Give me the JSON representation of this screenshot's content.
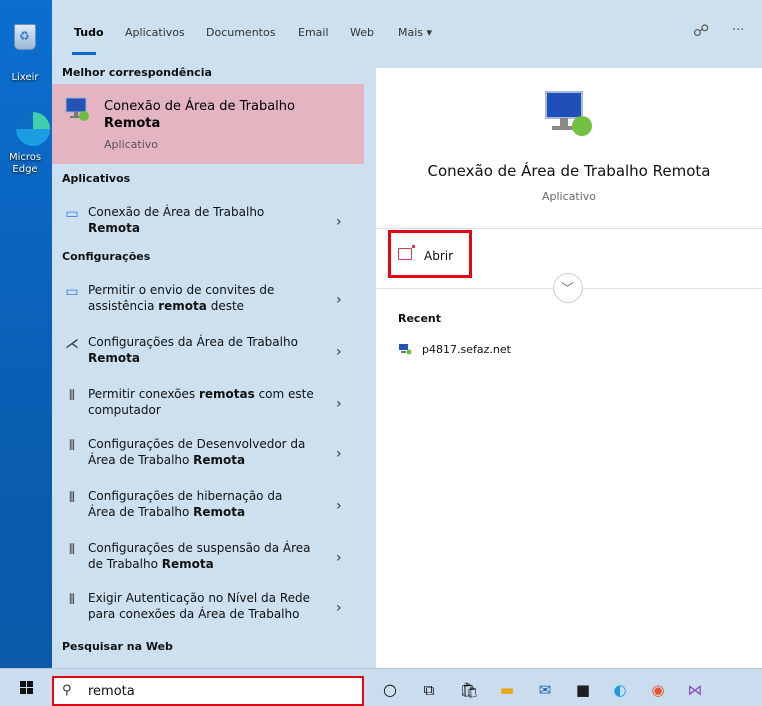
{
  "desktop": {
    "icons": [
      {
        "label": "Lixeir",
        "icon": "recycle-bin-icon"
      },
      {
        "label": "Micros\nEdge",
        "icon": "edge-icon"
      }
    ]
  },
  "tabs": [
    "Tudo",
    "Aplicativos",
    "Documentos",
    "Email",
    "Web",
    "Mais ▾"
  ],
  "header_icons": [
    "feedback-icon",
    "more-icon"
  ],
  "best_match": {
    "section": "Melhor correspondência",
    "title_line1": "Conexão de Área de Trabalho",
    "title_line2": "Remota",
    "subtitle": "Aplicativo"
  },
  "apps": {
    "section": "Aplicativos",
    "items": [
      {
        "line1": "Conexão de Área de Trabalho",
        "line2": "Remota"
      }
    ]
  },
  "settings": {
    "section": "Configurações",
    "items": [
      {
        "pre": "Permitir o envio de convites de",
        "line2_pre": "assistência ",
        "bold": "remota",
        "post": " deste"
      },
      {
        "pre": "Configurações da Área de Trabalho",
        "line2_pre": "",
        "bold": "Remota",
        "post": ""
      },
      {
        "pre": "Permitir conexões ",
        "bold_inline": "remotas",
        "pre_after": " com este",
        "line2_pre": "computador"
      },
      {
        "pre": "Configurações de Desenvolvedor da",
        "line2_pre": "Área de Trabalho ",
        "bold": "Remota",
        "post": ""
      },
      {
        "pre": "Configurações de hibernação da",
        "line2_pre": "Área de Trabalho ",
        "bold": "Remota",
        "post": ""
      },
      {
        "pre": "Configurações de suspensão da Área",
        "line2_pre": "de Trabalho ",
        "bold": "Remota",
        "post": ""
      },
      {
        "pre": "Exigir Autenticação no Nível da Rede",
        "line2_pre": "para conexões da Área de Trabalho",
        "bold": "",
        "post": ""
      }
    ]
  },
  "web": {
    "section": "Pesquisar na Web"
  },
  "detail": {
    "title": "Conexão de Área de Trabalho Remota",
    "subtitle": "Aplicativo",
    "open_label": "Abrir",
    "recent_title": "Recent",
    "recent_items": [
      "p4817.sefaz.net"
    ]
  },
  "search": {
    "value": "remota"
  },
  "colors": {
    "accent": "#0a6ad0",
    "highlight": "#e4b4c1",
    "panel": "#cce0ef",
    "callout": "#e30613"
  }
}
